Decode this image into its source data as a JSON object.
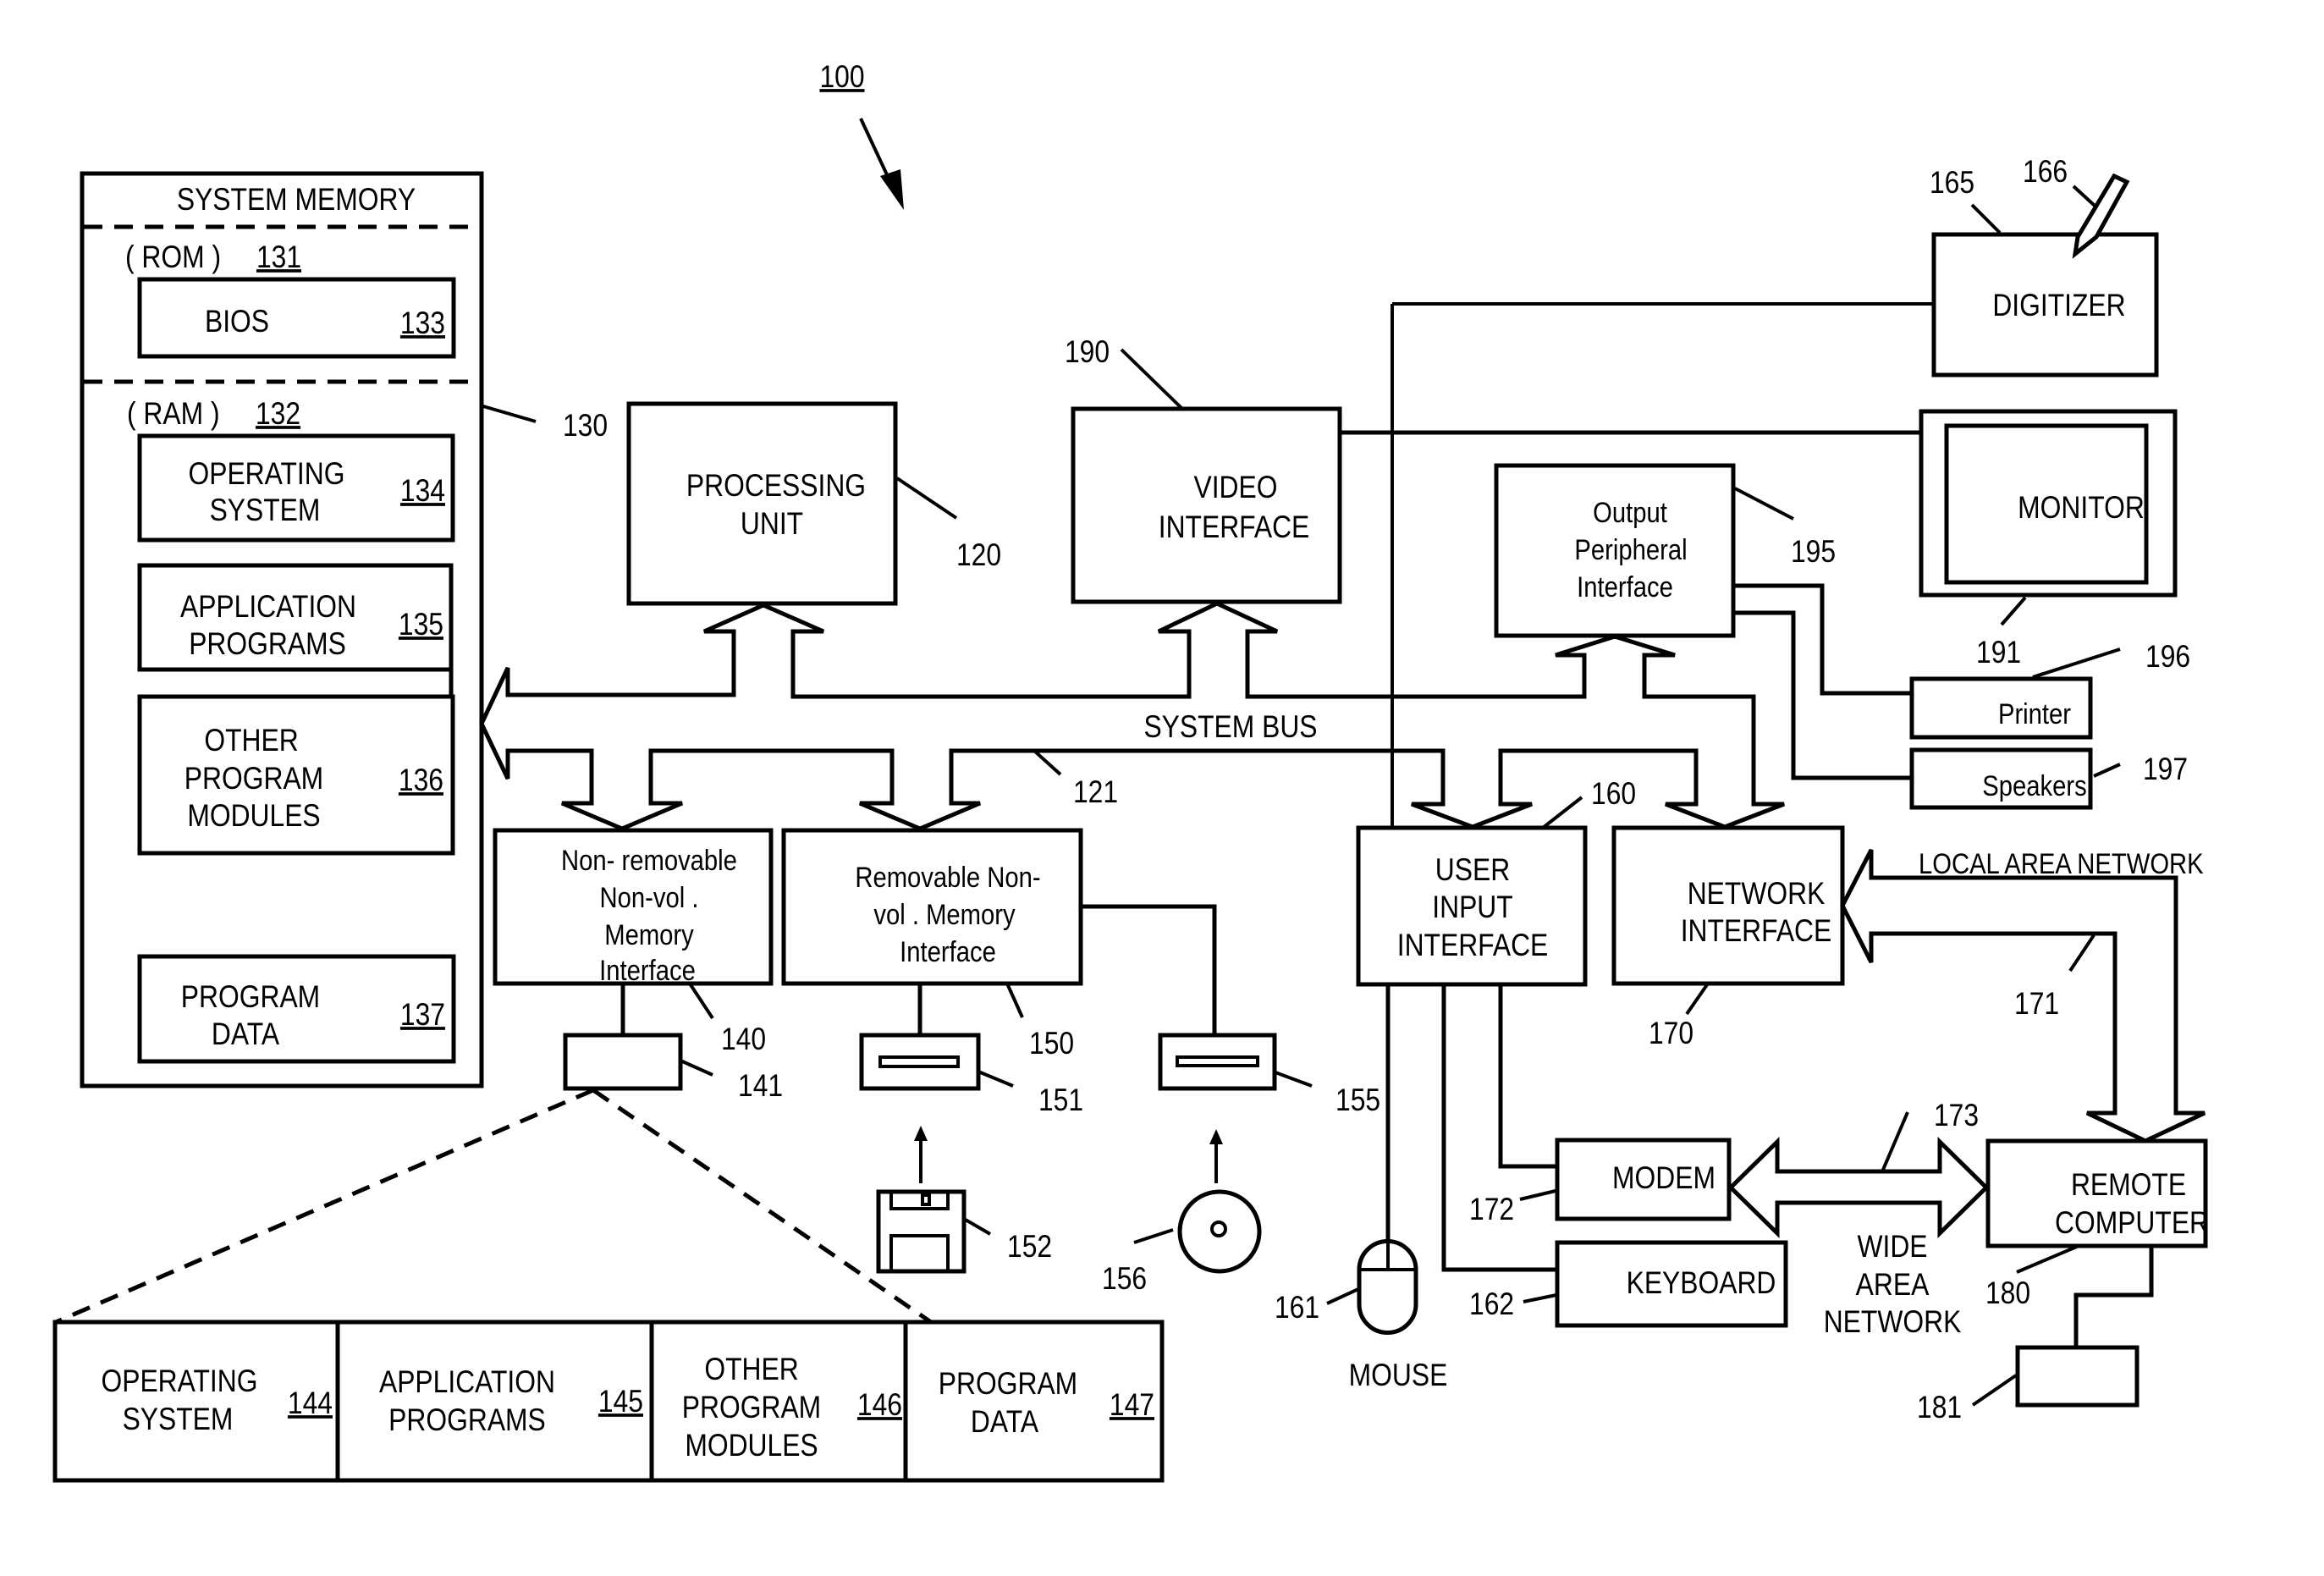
{
  "figure": {
    "ref": "100",
    "system_memory": {
      "title": "SYSTEM MEMORY",
      "ref": "130",
      "rom": {
        "label": "( ROM )",
        "ref": "131"
      },
      "ram": {
        "label": "( RAM )",
        "ref": "132"
      },
      "bios": {
        "label": "BIOS",
        "ref": "133"
      },
      "os": {
        "line1": "OPERATING",
        "line2": "SYSTEM",
        "ref": "134"
      },
      "apps": {
        "line1": "APPLICATION",
        "line2": "PROGRAMS",
        "ref": "135"
      },
      "other": {
        "line1": "OTHER",
        "line2": "PROGRAM",
        "line3": "MODULES",
        "ref": "136"
      },
      "data": {
        "line1": "PROGRAM",
        "line2": "DATA",
        "ref": "137"
      }
    },
    "processing_unit": {
      "line1": "PROCESSING",
      "line2": "UNIT",
      "ref": "120"
    },
    "video_interface": {
      "line1": "VIDEO",
      "line2": "INTERFACE",
      "ref": "190"
    },
    "output_peripheral": {
      "line1": "Output",
      "line2": "Peripheral",
      "line3": "Interface",
      "ref": "195"
    },
    "digitizer": {
      "label": "DIGITIZER",
      "ref": "165",
      "pen_ref": "166"
    },
    "monitor": {
      "label": "MONITOR",
      "ref": "191"
    },
    "printer": {
      "label": "Printer",
      "ref": "196"
    },
    "speakers": {
      "label": "Speakers",
      "ref": "197"
    },
    "system_bus": {
      "label": "SYSTEM BUS",
      "ref": "121"
    },
    "nonremovable": {
      "line1": "Non-  removable",
      "line2": "Non-vol .",
      "line3": "Memory",
      "line4": "Interface",
      "ref": "140",
      "device_ref": "141"
    },
    "removable": {
      "line1": "Removable Non-",
      "line2": "vol .  Memory",
      "line3": "Interface",
      "ref": "150",
      "device_ref": "151",
      "floppy_ref": "152",
      "optical_drive_ref": "155",
      "disc_ref": "156"
    },
    "user_input": {
      "line1": "USER",
      "line2": "INPUT",
      "line3": "INTERFACE",
      "ref": "160"
    },
    "network_interface": {
      "line1": "NETWORK",
      "line2": "INTERFACE",
      "ref": "170"
    },
    "lan": {
      "label": "LOCAL AREA NETWORK",
      "ref": "171"
    },
    "wan": {
      "line1": "WIDE",
      "line2": "AREA",
      "line3": "NETWORK",
      "ref": "173"
    },
    "modem": {
      "label": "MODEM",
      "ref": "172"
    },
    "keyboard": {
      "label": "KEYBOARD",
      "ref": "162"
    },
    "mouse": {
      "label": "MOUSE",
      "ref": "161"
    },
    "remote_computer": {
      "line1": "REMOTE",
      "line2": "COMPUTER",
      "ref": "180",
      "device_ref": "181"
    },
    "storage_table": [
      {
        "line1": "OPERATING",
        "line2": "SYSTEM",
        "line3": "",
        "ref": "144"
      },
      {
        "line1": "APPLICATION",
        "line2": "PROGRAMS",
        "line3": "",
        "ref": "145"
      },
      {
        "line1": "OTHER",
        "line2": "PROGRAM",
        "line3": "MODULES",
        "ref": "146"
      },
      {
        "line1": "PROGRAM",
        "line2": "DATA",
        "line3": "",
        "ref": "147"
      }
    ]
  }
}
